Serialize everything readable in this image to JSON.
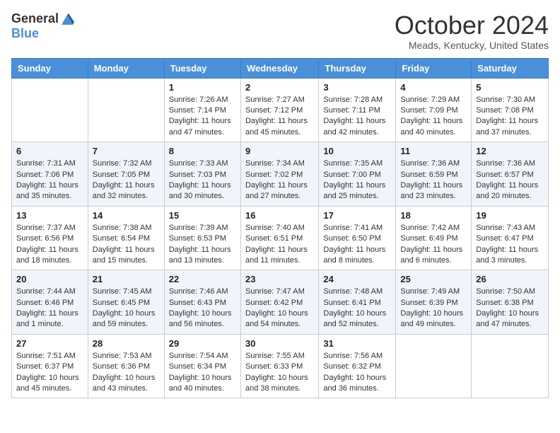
{
  "header": {
    "logo": {
      "general": "General",
      "blue": "Blue"
    },
    "title": "October 2024",
    "location": "Meads, Kentucky, United States"
  },
  "days_of_week": [
    "Sunday",
    "Monday",
    "Tuesday",
    "Wednesday",
    "Thursday",
    "Friday",
    "Saturday"
  ],
  "weeks": [
    [
      {
        "day": "",
        "info": ""
      },
      {
        "day": "",
        "info": ""
      },
      {
        "day": "1",
        "info": "Sunrise: 7:26 AM\nSunset: 7:14 PM\nDaylight: 11 hours and 47 minutes."
      },
      {
        "day": "2",
        "info": "Sunrise: 7:27 AM\nSunset: 7:12 PM\nDaylight: 11 hours and 45 minutes."
      },
      {
        "day": "3",
        "info": "Sunrise: 7:28 AM\nSunset: 7:11 PM\nDaylight: 11 hours and 42 minutes."
      },
      {
        "day": "4",
        "info": "Sunrise: 7:29 AM\nSunset: 7:09 PM\nDaylight: 11 hours and 40 minutes."
      },
      {
        "day": "5",
        "info": "Sunrise: 7:30 AM\nSunset: 7:08 PM\nDaylight: 11 hours and 37 minutes."
      }
    ],
    [
      {
        "day": "6",
        "info": "Sunrise: 7:31 AM\nSunset: 7:06 PM\nDaylight: 11 hours and 35 minutes."
      },
      {
        "day": "7",
        "info": "Sunrise: 7:32 AM\nSunset: 7:05 PM\nDaylight: 11 hours and 32 minutes."
      },
      {
        "day": "8",
        "info": "Sunrise: 7:33 AM\nSunset: 7:03 PM\nDaylight: 11 hours and 30 minutes."
      },
      {
        "day": "9",
        "info": "Sunrise: 7:34 AM\nSunset: 7:02 PM\nDaylight: 11 hours and 27 minutes."
      },
      {
        "day": "10",
        "info": "Sunrise: 7:35 AM\nSunset: 7:00 PM\nDaylight: 11 hours and 25 minutes."
      },
      {
        "day": "11",
        "info": "Sunrise: 7:36 AM\nSunset: 6:59 PM\nDaylight: 11 hours and 23 minutes."
      },
      {
        "day": "12",
        "info": "Sunrise: 7:36 AM\nSunset: 6:57 PM\nDaylight: 11 hours and 20 minutes."
      }
    ],
    [
      {
        "day": "13",
        "info": "Sunrise: 7:37 AM\nSunset: 6:56 PM\nDaylight: 11 hours and 18 minutes."
      },
      {
        "day": "14",
        "info": "Sunrise: 7:38 AM\nSunset: 6:54 PM\nDaylight: 11 hours and 15 minutes."
      },
      {
        "day": "15",
        "info": "Sunrise: 7:39 AM\nSunset: 6:53 PM\nDaylight: 11 hours and 13 minutes."
      },
      {
        "day": "16",
        "info": "Sunrise: 7:40 AM\nSunset: 6:51 PM\nDaylight: 11 hours and 11 minutes."
      },
      {
        "day": "17",
        "info": "Sunrise: 7:41 AM\nSunset: 6:50 PM\nDaylight: 11 hours and 8 minutes."
      },
      {
        "day": "18",
        "info": "Sunrise: 7:42 AM\nSunset: 6:49 PM\nDaylight: 11 hours and 6 minutes."
      },
      {
        "day": "19",
        "info": "Sunrise: 7:43 AM\nSunset: 6:47 PM\nDaylight: 11 hours and 3 minutes."
      }
    ],
    [
      {
        "day": "20",
        "info": "Sunrise: 7:44 AM\nSunset: 6:46 PM\nDaylight: 11 hours and 1 minute."
      },
      {
        "day": "21",
        "info": "Sunrise: 7:45 AM\nSunset: 6:45 PM\nDaylight: 10 hours and 59 minutes."
      },
      {
        "day": "22",
        "info": "Sunrise: 7:46 AM\nSunset: 6:43 PM\nDaylight: 10 hours and 56 minutes."
      },
      {
        "day": "23",
        "info": "Sunrise: 7:47 AM\nSunset: 6:42 PM\nDaylight: 10 hours and 54 minutes."
      },
      {
        "day": "24",
        "info": "Sunrise: 7:48 AM\nSunset: 6:41 PM\nDaylight: 10 hours and 52 minutes."
      },
      {
        "day": "25",
        "info": "Sunrise: 7:49 AM\nSunset: 6:39 PM\nDaylight: 10 hours and 49 minutes."
      },
      {
        "day": "26",
        "info": "Sunrise: 7:50 AM\nSunset: 6:38 PM\nDaylight: 10 hours and 47 minutes."
      }
    ],
    [
      {
        "day": "27",
        "info": "Sunrise: 7:51 AM\nSunset: 6:37 PM\nDaylight: 10 hours and 45 minutes."
      },
      {
        "day": "28",
        "info": "Sunrise: 7:53 AM\nSunset: 6:36 PM\nDaylight: 10 hours and 43 minutes."
      },
      {
        "day": "29",
        "info": "Sunrise: 7:54 AM\nSunset: 6:34 PM\nDaylight: 10 hours and 40 minutes."
      },
      {
        "day": "30",
        "info": "Sunrise: 7:55 AM\nSunset: 6:33 PM\nDaylight: 10 hours and 38 minutes."
      },
      {
        "day": "31",
        "info": "Sunrise: 7:56 AM\nSunset: 6:32 PM\nDaylight: 10 hours and 36 minutes."
      },
      {
        "day": "",
        "info": ""
      },
      {
        "day": "",
        "info": ""
      }
    ]
  ]
}
